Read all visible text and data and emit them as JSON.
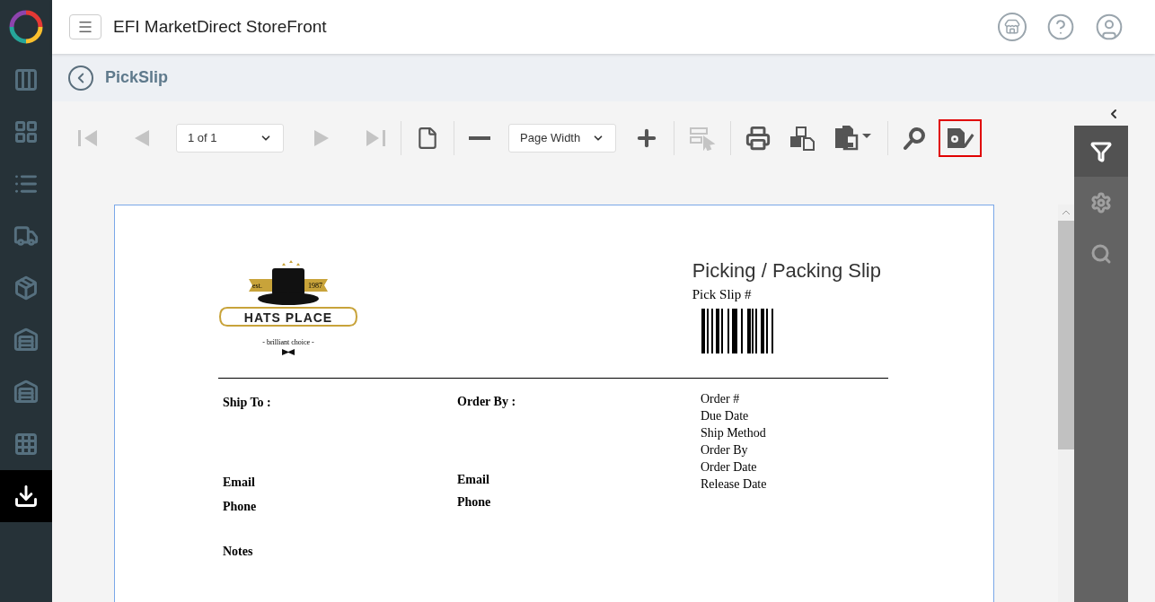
{
  "app": {
    "title": "EFI MarketDirect StoreFront"
  },
  "sidebar": {
    "items": [
      {
        "selected": false
      },
      {
        "selected": false
      },
      {
        "selected": false
      },
      {
        "selected": false
      },
      {
        "selected": false
      },
      {
        "selected": false
      },
      {
        "selected": false
      },
      {
        "selected": false
      },
      {
        "selected": true
      }
    ]
  },
  "page": {
    "title": "PickSlip"
  },
  "toolbar": {
    "page_select": "1 of 1",
    "zoom_select": "Page Width",
    "buttons": [
      {
        "disabled": true,
        "selected": false
      },
      {
        "disabled": true,
        "selected": false
      },
      {
        "disabled": true,
        "selected": false
      },
      {
        "disabled": true,
        "selected": false
      },
      {
        "disabled": false,
        "selected": false
      },
      {
        "disabled": false,
        "selected": false
      },
      {
        "disabled": false,
        "selected": false
      },
      {
        "disabled": true,
        "selected": false
      },
      {
        "disabled": false,
        "selected": false
      },
      {
        "disabled": false,
        "selected": false
      },
      {
        "disabled": false,
        "selected": false
      },
      {
        "disabled": false,
        "selected": false
      },
      {
        "disabled": false,
        "selected": true
      }
    ]
  },
  "right_panel": {
    "items": [
      {
        "selected": true
      },
      {
        "selected": false
      },
      {
        "selected": false
      }
    ]
  },
  "document": {
    "logo": {
      "est": "est.",
      "year": "1987",
      "name": "HATS PLACE",
      "tagline": "- brilliant choice -"
    },
    "title": "Picking / Packing Slip",
    "pick_slip_label": "Pick Slip #",
    "ship_to": {
      "heading": "Ship To :",
      "email": "Email",
      "phone": "Phone",
      "notes": "Notes"
    },
    "order_by": {
      "heading": "Order By :",
      "email": "Email",
      "phone": "Phone"
    },
    "order_fields": [
      "Order #",
      "Due Date",
      "Ship Method",
      "Order By",
      "Order Date",
      "Release Date"
    ]
  }
}
